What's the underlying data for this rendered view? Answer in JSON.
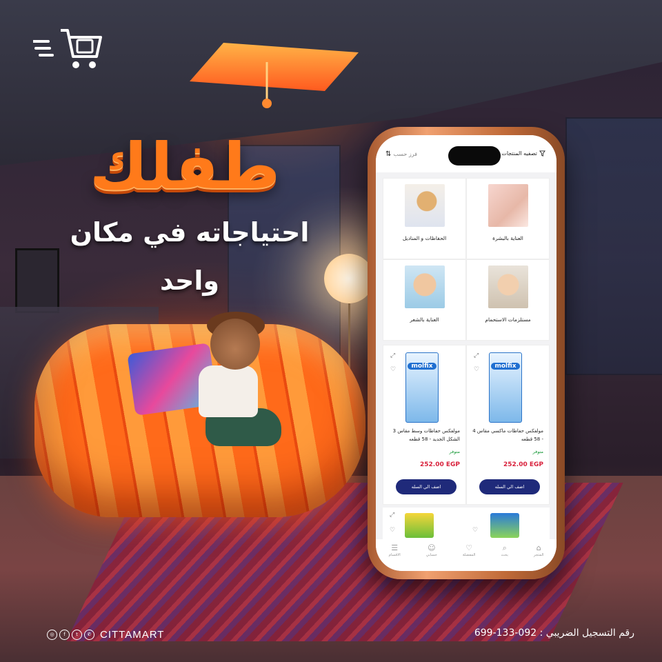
{
  "headline": {
    "title": "طفلك",
    "subtitle": "احتياجاته في مكان واحد"
  },
  "app": {
    "filter_label": "تصفيه المنتجات",
    "sort_label": "فرز حسب",
    "categories": [
      {
        "label": "الحفاظات و المناديل"
      },
      {
        "label": "العناية بالبشرة"
      },
      {
        "label": "العناية بالشعر"
      },
      {
        "label": "مستلزمات الاستحمام"
      }
    ],
    "products": [
      {
        "brand": "molfix",
        "name": "مولفكس حفاظات وسط مقاس 3 الشكل الجديد - 58 قطعه",
        "stock": "متوفر",
        "price": "252.00 EGP",
        "button": "اضف الي السله"
      },
      {
        "brand": "molfix",
        "name": "مولفكس حفاظات ماكسي مقاس 4 - 58 قطعه",
        "stock": "متوفر",
        "price": "252.00 EGP",
        "button": "اضف الي السله"
      }
    ],
    "nav": [
      {
        "label": "المتجر",
        "icon": "store-icon"
      },
      {
        "label": "بحث",
        "icon": "search-icon"
      },
      {
        "label": "المفضلة",
        "icon": "heart-icon"
      },
      {
        "label": "حسابي",
        "icon": "user-icon"
      },
      {
        "label": "الاقسام",
        "icon": "menu-icon"
      }
    ]
  },
  "footer": {
    "brand": "CITTAMART",
    "tax_id": "رقم التسجيل الضريبي : 092-133-699"
  },
  "colors": {
    "accent_orange": "#ff7a1a",
    "button_navy": "#1f2a7a",
    "price_red": "#d81f3a",
    "stock_green": "#1a9a3a"
  }
}
